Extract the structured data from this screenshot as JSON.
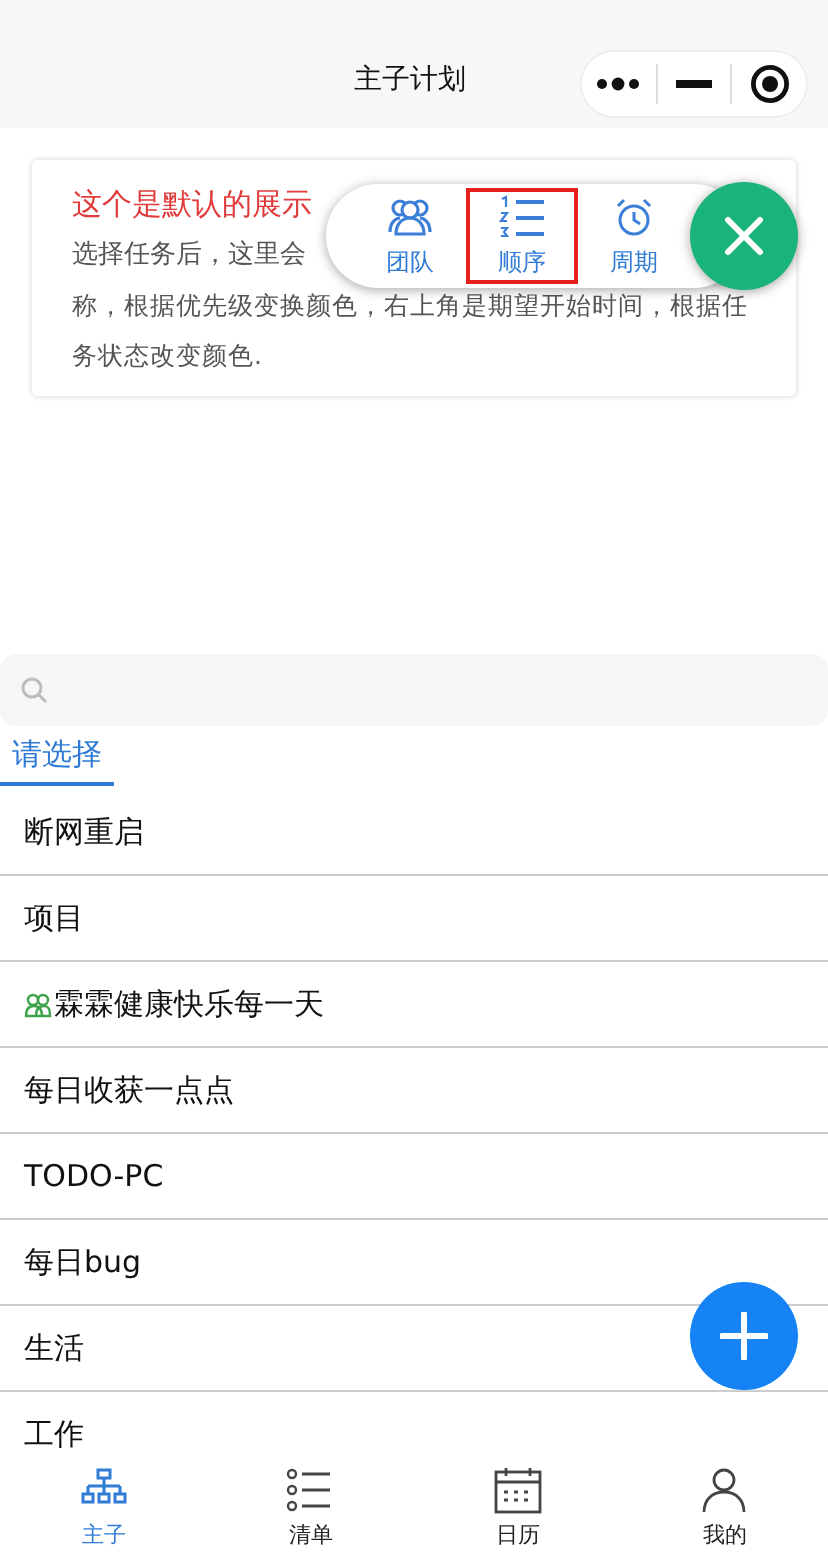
{
  "header": {
    "title": "主子计划"
  },
  "card": {
    "title": "这个是默认的展示",
    "line_1": "选择任务后，这里会",
    "rest": "称，根据优先级变换颜色，右上角是期望开始时间，根据任务状态改变颜色."
  },
  "popup": {
    "options": [
      {
        "kind": "team",
        "label": "团队",
        "selected": false
      },
      {
        "kind": "order",
        "label": "顺序",
        "selected": true
      },
      {
        "kind": "cycle",
        "label": "周期",
        "selected": false
      }
    ]
  },
  "tabs": [
    {
      "label": "请选择",
      "selected": true
    }
  ],
  "list": [
    {
      "kind": "plain",
      "label": "断网重启"
    },
    {
      "kind": "plain",
      "label": "项目"
    },
    {
      "kind": "team",
      "label": "霖霖健康快乐每一天"
    },
    {
      "kind": "plain",
      "label": "每日收获一点点"
    },
    {
      "kind": "plain",
      "label": "TODO-PC"
    },
    {
      "kind": "plain",
      "label": "每日bug"
    },
    {
      "kind": "plain",
      "label": "生活"
    },
    {
      "kind": "plain",
      "label": "工作"
    }
  ],
  "nav": [
    {
      "kind": "tree",
      "label": "主子",
      "selected": true
    },
    {
      "kind": "list",
      "label": "清单",
      "selected": false
    },
    {
      "kind": "calendar",
      "label": "日历",
      "selected": false
    },
    {
      "kind": "person",
      "label": "我的",
      "selected": false
    }
  ]
}
